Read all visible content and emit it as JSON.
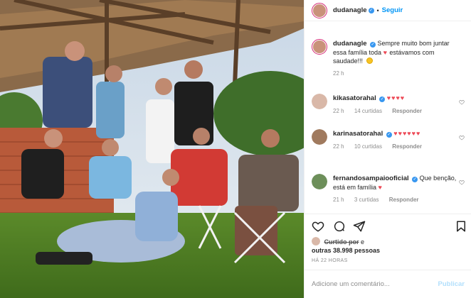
{
  "post": {
    "photo_alt": "",
    "author": "dudanagle",
    "follow_label": "Seguir",
    "caption": "Sempre muito bom juntar essa família toda",
    "caption_tail": "estávamos com saudade!!!",
    "caption_time": "22 h"
  },
  "comments": [
    {
      "user": "kikasatorahal",
      "text": "",
      "hearts": "♥♥♥♥",
      "time": "22 h",
      "likes": "14 curtidas",
      "reply": "Responder"
    },
    {
      "user": "karinasatorahal",
      "text": "",
      "hearts": "♥♥♥♥♥♥",
      "time": "22 h",
      "likes": "10 curtidas",
      "reply": "Responder"
    },
    {
      "user": "fernandosampaiooficial",
      "text": "Que benção, está em família",
      "hearts": "♥",
      "time": "21 h",
      "likes": "3 curtidas",
      "reply": "Responder"
    }
  ],
  "likes": {
    "prefix": "Curtido por",
    "others": "outras 38.998 pessoas",
    "conj": "e"
  },
  "timestamp": "HÁ 22 HORAS",
  "add_comment": {
    "placeholder": "Adicione um comentário...",
    "publish_label": "Publicar"
  },
  "icons": [
    "verified-icon",
    "heart-icon",
    "comment-icon",
    "share-icon",
    "bookmark-icon",
    "sun-emoji-icon"
  ],
  "colors": {
    "link": "#0095f6",
    "heart": "#ed4956",
    "publish_disabled": "#b2dffc",
    "muted": "#8e8e8e"
  }
}
